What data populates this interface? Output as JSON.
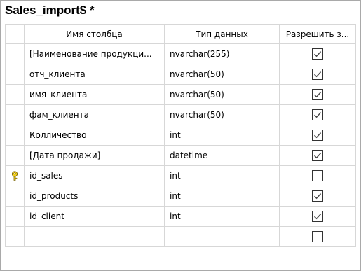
{
  "window": {
    "title": "Sales_import$ *"
  },
  "columns": {
    "name": "Имя столбца",
    "type": "Тип данных",
    "nullable": "Разрешить з..."
  },
  "rows": [
    {
      "name": "[Наименование продукци...",
      "type": "nvarchar(255)",
      "nullable": true,
      "key": false
    },
    {
      "name": "отч_клиента",
      "type": "nvarchar(50)",
      "nullable": true,
      "key": false
    },
    {
      "name": "имя_клиента",
      "type": "nvarchar(50)",
      "nullable": true,
      "key": false
    },
    {
      "name": "фам_клиента",
      "type": "nvarchar(50)",
      "nullable": true,
      "key": false
    },
    {
      "name": "Колличество",
      "type": "int",
      "nullable": true,
      "key": false
    },
    {
      "name": "[Дата продажи]",
      "type": "datetime",
      "nullable": true,
      "key": false
    },
    {
      "name": "id_sales",
      "type": "int",
      "nullable": false,
      "key": true
    },
    {
      "name": "id_products",
      "type": "int",
      "nullable": true,
      "key": false
    },
    {
      "name": "id_client",
      "type": "int",
      "nullable": true,
      "key": false
    },
    {
      "name": "",
      "type": "",
      "nullable": false,
      "key": false
    }
  ],
  "icons": {
    "primary_key": "key-icon",
    "checked": "checkmark-icon"
  }
}
